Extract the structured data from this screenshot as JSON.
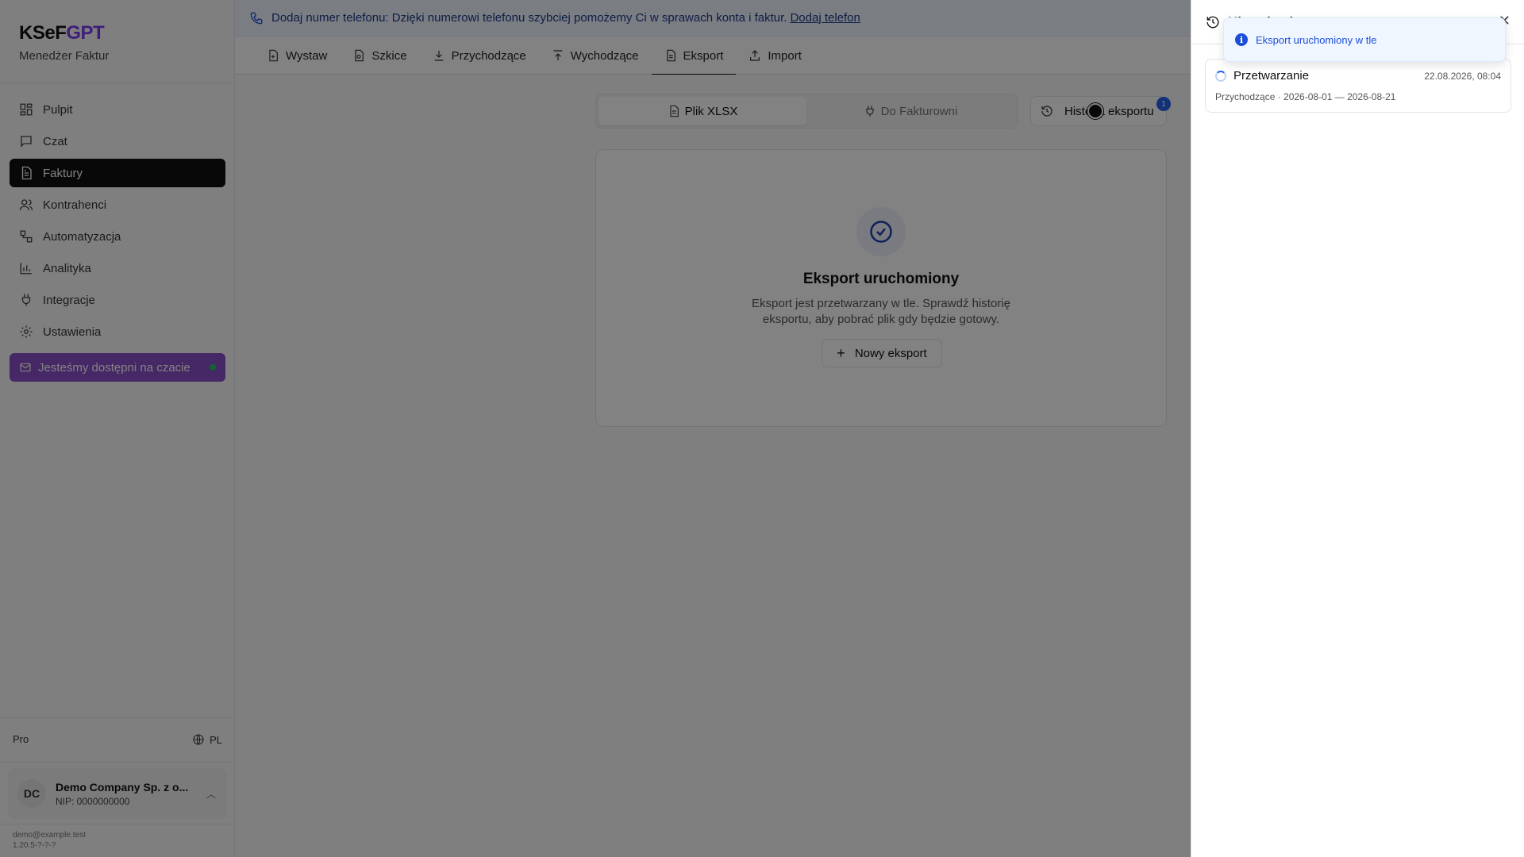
{
  "brand": {
    "logo_a": "KSeF",
    "logo_b": "GPT",
    "subtitle": "Menedżer Faktur"
  },
  "sidebar": {
    "items": [
      {
        "label": "Pulpit",
        "icon": "dashboard-icon"
      },
      {
        "label": "Czat",
        "icon": "chat-icon"
      },
      {
        "label": "Faktury",
        "icon": "invoice-icon",
        "active": true
      },
      {
        "label": "Kontrahenci",
        "icon": "users-icon"
      },
      {
        "label": "Automatyzacja",
        "icon": "workflow-icon"
      },
      {
        "label": "Analityka",
        "icon": "chart-icon"
      },
      {
        "label": "Integracje",
        "icon": "plug-icon"
      },
      {
        "label": "Ustawienia",
        "icon": "gear-icon"
      }
    ],
    "chat_cta": "Jesteśmy dostępni na czacie",
    "plan": "Pro",
    "language": "PL",
    "company": {
      "initials": "DC",
      "name": "Demo Company Sp. z o...",
      "nip": "NIP: 0000000000"
    },
    "email": "demo@example.test",
    "version": "1.20.5-?-?-?"
  },
  "banner": {
    "text": "Dodaj numer telefonu: Dzięki numerowi telefonu szybciej pomożemy Ci w sprawach konta i faktur.",
    "link": "Dodaj telefon"
  },
  "tabs": [
    {
      "label": "Wystaw",
      "icon": "file-plus-icon"
    },
    {
      "label": "Szkice",
      "icon": "draft-icon"
    },
    {
      "label": "Przychodzące",
      "icon": "download-icon"
    },
    {
      "label": "Wychodzące",
      "icon": "upload-icon"
    },
    {
      "label": "Eksport",
      "icon": "file-text-icon",
      "active": true
    },
    {
      "label": "Import",
      "icon": "import-icon"
    }
  ],
  "export": {
    "format_xlsx": "Plik XLSX",
    "format_fakturownia": "Do Fakturowni",
    "history_button": "Historia eksportu",
    "history_badge": "1",
    "title": "Eksport uruchomiony",
    "description": "Eksport jest przetwarzany w tle. Sprawdź historię eksportu, aby pobrać plik gdy będzie gotowy.",
    "new_export": "Nowy eksport"
  },
  "panel": {
    "title": "Historia eksportu",
    "close": "✕",
    "toast": "Eksport uruchomiony w tle",
    "entries": [
      {
        "status": "Przetwarzanie",
        "date": "22.08.2026, 08:04",
        "meta": "Przychodzące · 2026-08-01 — 2026-08-21"
      }
    ]
  },
  "colors": {
    "accent": "#7c3aed",
    "cta": "#8b4fc8",
    "info": "#1d4ed8"
  }
}
